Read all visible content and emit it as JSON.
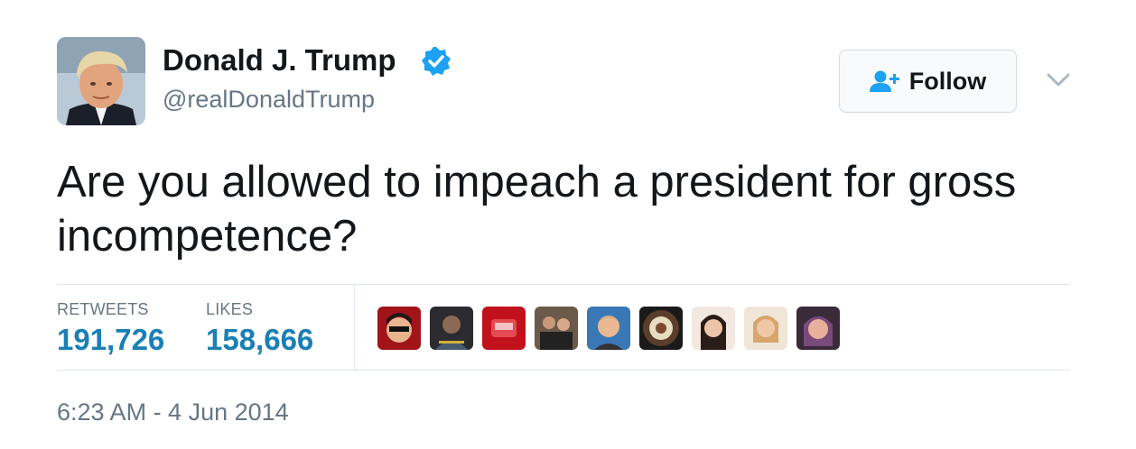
{
  "user": {
    "name": "Donald J. Trump",
    "handle": "@realDonaldTrump",
    "verified": true,
    "avatar_icon": "profile-photo"
  },
  "follow_button": {
    "label": "Follow",
    "icon": "add-user-icon",
    "accent": "#1da1f2"
  },
  "tweet": {
    "text": "Are you allowed to impeach a president for gross incompetence?"
  },
  "stats": {
    "retweets_label": "RETWEETS",
    "retweets_value": "191,726",
    "likes_label": "LIKES",
    "likes_value": "158,666"
  },
  "likers": [
    {
      "icon": "liker-avatar-1",
      "color": "#a0141a"
    },
    {
      "icon": "liker-avatar-2",
      "color": "#2b2b30"
    },
    {
      "icon": "liker-avatar-3",
      "color": "#c1121c"
    },
    {
      "icon": "liker-avatar-4",
      "color": "#6b5a4a"
    },
    {
      "icon": "liker-avatar-5",
      "color": "#3a78b5"
    },
    {
      "icon": "liker-avatar-6",
      "color": "#5a3d2b"
    },
    {
      "icon": "liker-avatar-7",
      "color": "#e8c9b5"
    },
    {
      "icon": "liker-avatar-8",
      "color": "#d8a66b"
    },
    {
      "icon": "liker-avatar-9",
      "color": "#7a4a7a"
    }
  ],
  "timestamp": "6:23 AM - 4 Jun 2014"
}
